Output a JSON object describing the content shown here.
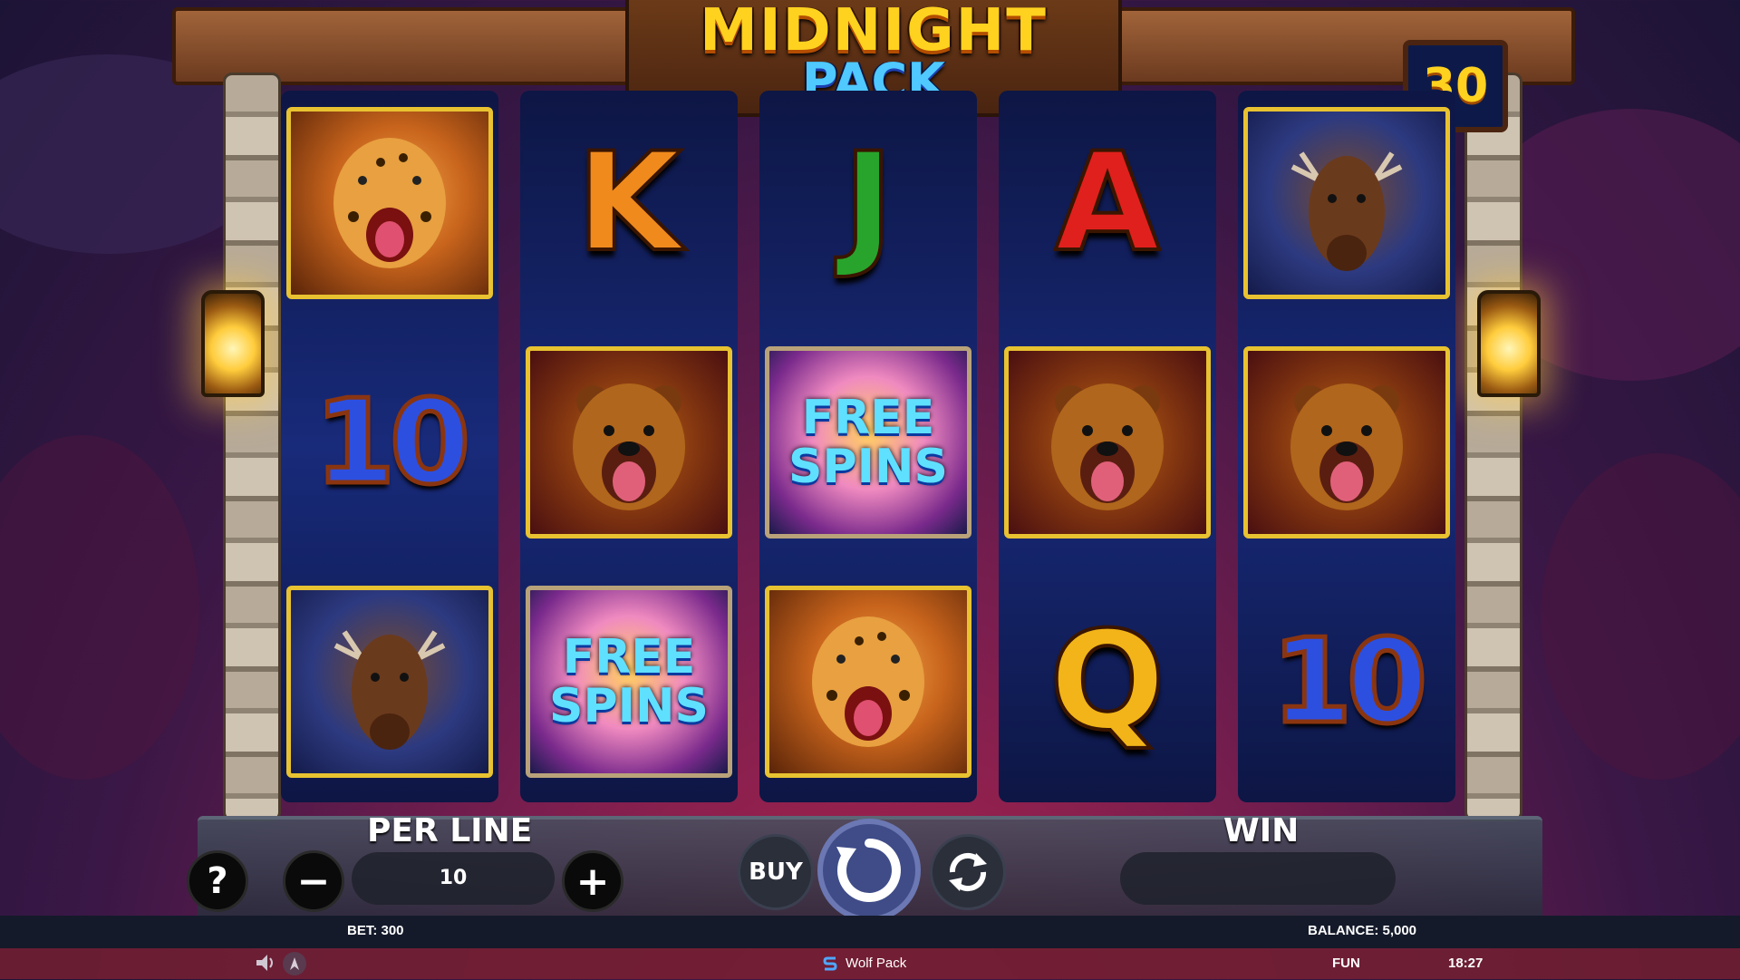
{
  "game": {
    "title_line1": "MIDNIGHT",
    "title_line2": "PACK",
    "counter": "30"
  },
  "reels": [
    [
      {
        "type": "jaguar"
      },
      {
        "type": "ten",
        "text": "10"
      },
      {
        "type": "moose"
      }
    ],
    [
      {
        "type": "letter",
        "text": "K",
        "color": "#f08a1c"
      },
      {
        "type": "bear"
      },
      {
        "type": "moon",
        "text1": "FREE",
        "text2": "SPINS"
      }
    ],
    [
      {
        "type": "letter",
        "text": "J",
        "color": "#28a42c"
      },
      {
        "type": "moon",
        "text1": "FREE",
        "text2": "SPINS"
      },
      {
        "type": "jaguar"
      }
    ],
    [
      {
        "type": "letter",
        "text": "A",
        "color": "#e0201c"
      },
      {
        "type": "bear"
      },
      {
        "type": "letter",
        "text": "Q",
        "color": "#f2b418"
      }
    ],
    [
      {
        "type": "moose"
      },
      {
        "type": "bear"
      },
      {
        "type": "ten",
        "text": "10"
      }
    ]
  ],
  "controls": {
    "per_line_label": "PER LINE",
    "per_line_value": "10",
    "help": "?",
    "minus": "−",
    "plus": "+",
    "buy": "BUY",
    "win_label": "WIN",
    "win_value": ""
  },
  "status": {
    "bet": "BET: 300",
    "balance": "BALANCE: 5,000",
    "brand": "Wolf Pack",
    "mode": "FUN",
    "time": "18:27"
  },
  "colors": {
    "accent_gold": "#ffd21f",
    "reel_blue": "#182a7a",
    "spin_button": "#3f4c88"
  }
}
